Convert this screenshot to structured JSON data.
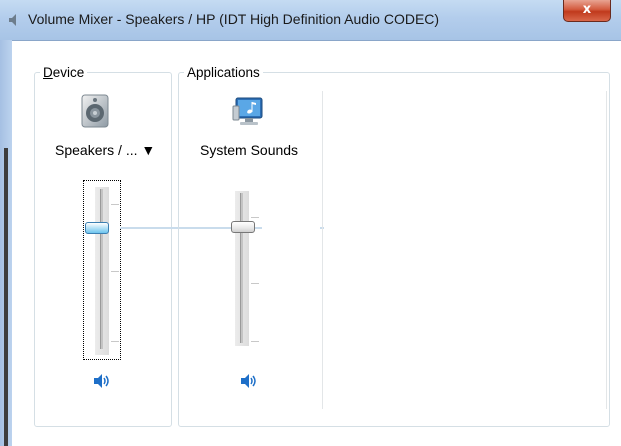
{
  "window": {
    "title": "Volume Mixer - Speakers / HP (IDT High Definition Audio CODEC)",
    "close_label": "x"
  },
  "device": {
    "group_label_accel": "D",
    "group_label_rest": "evice",
    "name": "Speakers / ... ▼",
    "icon": "speaker-device-icon",
    "volume_percent": 70,
    "mute_icon": "speaker-volume-icon"
  },
  "applications": {
    "group_label": "Applications",
    "items": [
      {
        "name": "System Sounds",
        "icon": "system-sounds-icon",
        "volume_percent": 70,
        "mute_icon": "speaker-volume-icon"
      }
    ]
  },
  "colors": {
    "accent_blue": "#1e6fc8",
    "titlebar": "#b3cdec",
    "close_red": "#c0391c"
  }
}
